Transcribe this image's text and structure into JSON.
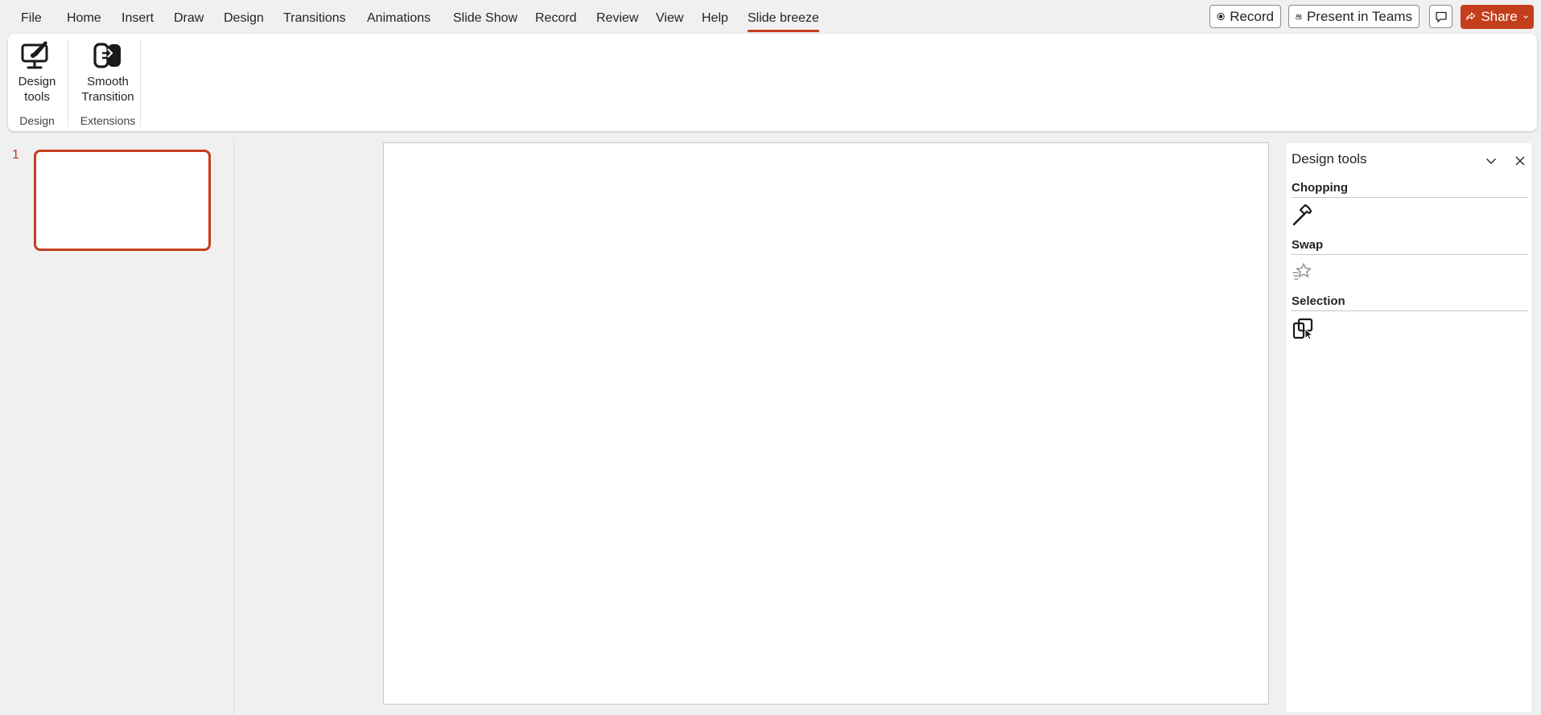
{
  "menu": {
    "tabs": [
      "File",
      "Home",
      "Insert",
      "Draw",
      "Design",
      "Transitions",
      "Animations",
      "Slide Show",
      "Record",
      "Review",
      "View",
      "Help",
      "Slide breeze"
    ],
    "active_tab": "Slide breeze",
    "record_label": "Record",
    "present_label": "Present in Teams",
    "share_label": "Share"
  },
  "ribbon": {
    "design_tools_label": "Design tools",
    "smooth_transition_label": "Smooth Transition",
    "group_design": "Design",
    "group_extensions": "Extensions"
  },
  "thumbnails": {
    "slides": [
      {
        "number": "1",
        "selected": true
      }
    ]
  },
  "pane": {
    "title": "Design tools",
    "sections": [
      {
        "title": "Chopping",
        "icon": "hammer-icon"
      },
      {
        "title": "Swap",
        "icon": "swap-icon"
      },
      {
        "title": "Selection",
        "icon": "selection-icon"
      }
    ]
  },
  "colors": {
    "accent": "#c43e1c",
    "background": "#f0f0f0",
    "surface": "#ffffff"
  }
}
